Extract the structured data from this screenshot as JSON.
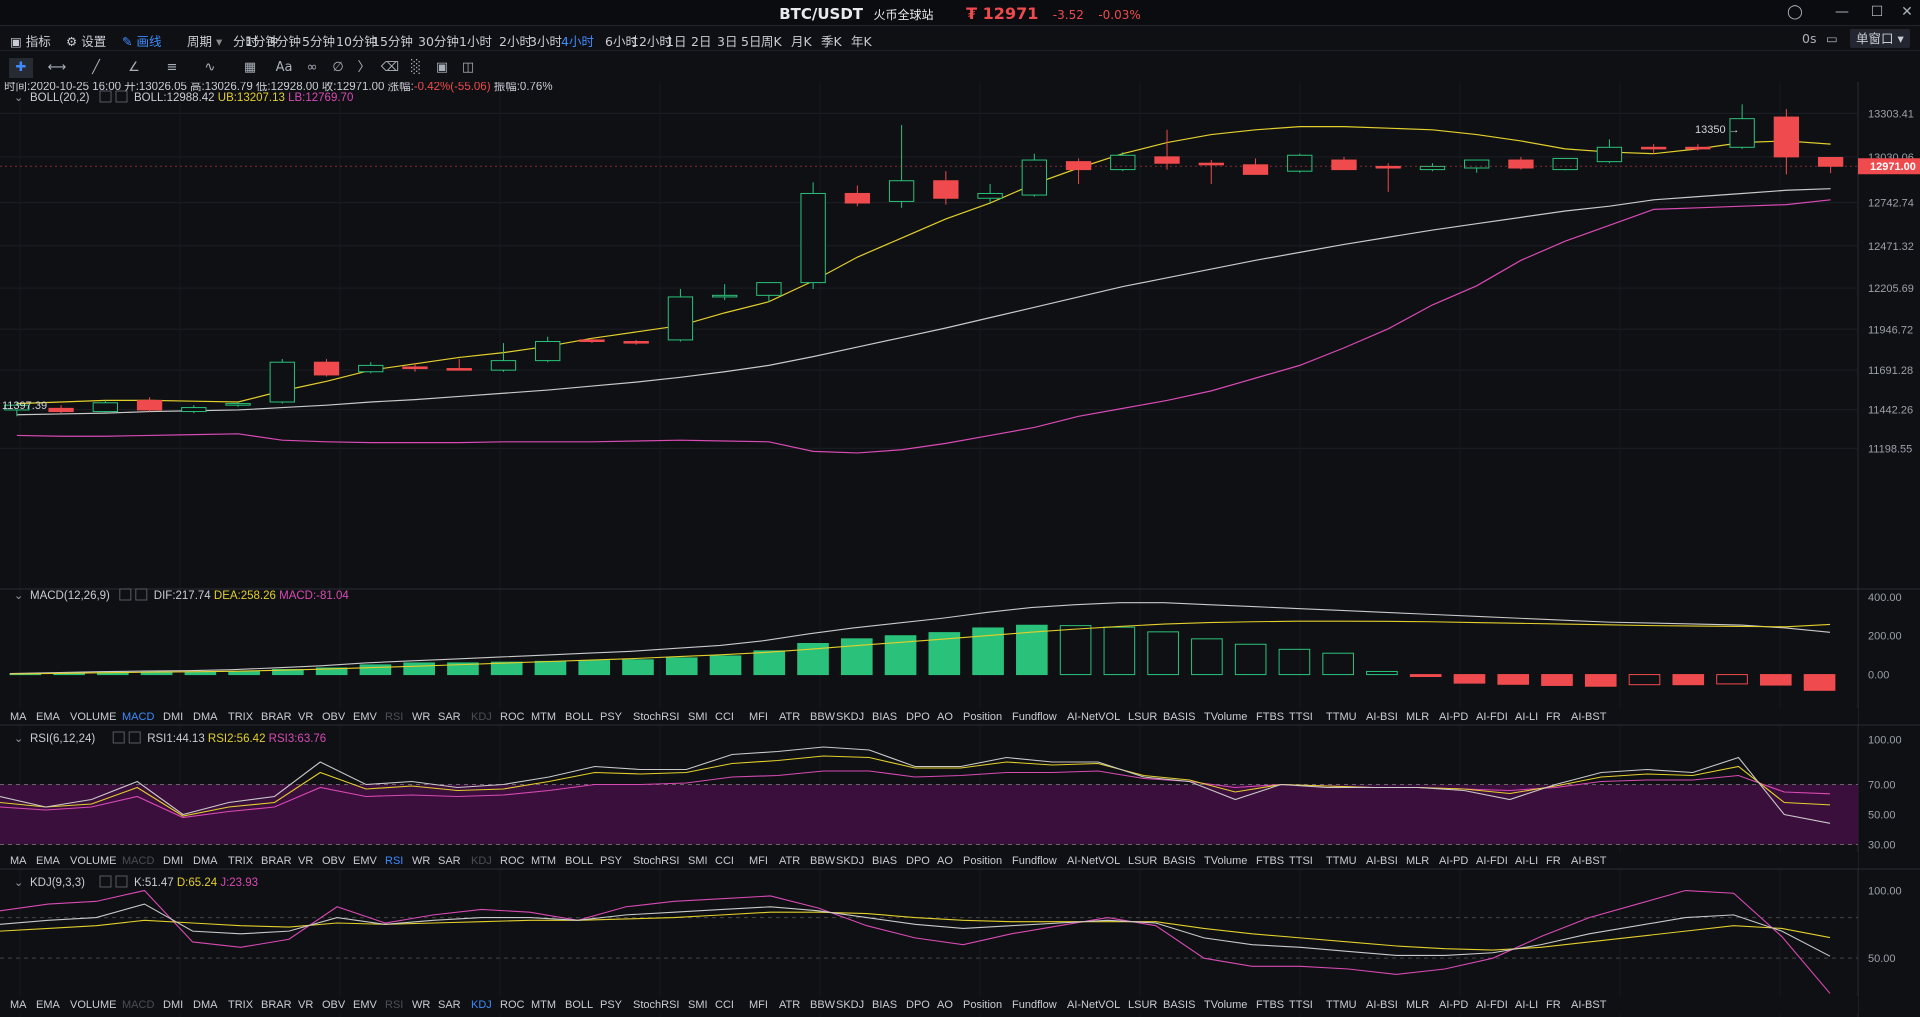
{
  "titlebar": {
    "pair": "BTC/USDT",
    "exchange": "火币全球站",
    "price": "₮ 12971",
    "change": "-3.52",
    "change_pct": "-0.03%"
  },
  "menu": {
    "indicators": "指标",
    "settings": "设置",
    "draw": "画线",
    "period": "周期",
    "timeframes": [
      "分时",
      "1分钟",
      "3分钟",
      "5分钟",
      "10分钟",
      "15分钟",
      "30分钟",
      "1小时",
      "2小时",
      "3小时",
      "4小时",
      "6小时",
      "12小时",
      "1日",
      "2日",
      "3日",
      "5日",
      "周K",
      "月K",
      "季K",
      "年K"
    ],
    "active_timeframe": "4小时",
    "refresh": "0s",
    "window_mode": "单窗口"
  },
  "ohlc_line": {
    "time": "时间:2020-10-25 16:00",
    "open": "开:13026.05",
    "high": "高:13026.79",
    "low": "低:12928.00",
    "close": "收:12971.00",
    "change": "涨幅:",
    "change_val": "-0.42%(-55.06)",
    "amp": "振幅:0.76%"
  },
  "boll_legend": {
    "name": "BOLL(20,2)",
    "mid": "BOLL:12988.42",
    "ub": "UB:13207.13",
    "lb": "LB:12769.70"
  },
  "macd_legend": {
    "name": "MACD(12,26,9)",
    "dif": "DIF:217.74",
    "dea": "DEA:258.26",
    "macd": "MACD:-81.04"
  },
  "rsi_legend": {
    "name": "RSI(6,12,24)",
    "r1": "RSI1:44.13",
    "r2": "RSI2:56.42",
    "r3": "RSI3:63.76"
  },
  "kdj_legend": {
    "name": "KDJ(9,3,3)",
    "k": "K:51.47",
    "d": "D:65.24",
    "j": "J:23.93"
  },
  "indicator_tabs": [
    "MA",
    "EMA",
    "VOLUME",
    "MACD",
    "DMI",
    "DMA",
    "TRIX",
    "BRAR",
    "VR",
    "OBV",
    "EMV",
    "RSI",
    "WR",
    "SAR",
    "KDJ",
    "ROC",
    "MTM",
    "BOLL",
    "PSY",
    "StochRSI",
    "SMI",
    "CCI",
    "MFI",
    "ATR",
    "BBW",
    "SKDJ",
    "BIAS",
    "DPO",
    "AO",
    "Position",
    "Fundflow",
    "AI-NetVOL",
    "LSUR",
    "BASIS",
    "TVolume",
    "FTBS",
    "TTSI",
    "TTMU",
    "AI-BSI",
    "MLR",
    "AI-PD",
    "AI-FDI",
    "AI-LI",
    "FR",
    "AI-BST"
  ],
  "tabs_bar1": {
    "active": "MACD",
    "dim": [
      "RSI",
      "KDJ"
    ]
  },
  "tabs_bar2": {
    "active": "RSI",
    "dim": [
      "MACD",
      "KDJ"
    ]
  },
  "tabs_bar3": {
    "active": "KDJ",
    "dim": [
      "MACD",
      "RSI"
    ]
  },
  "colors": {
    "up": "#2ac27a",
    "down": "#ef4a4d",
    "boll_mid": "#c9c9c9",
    "boll_ub": "#e3cf2c",
    "boll_lb": "#d94ab4",
    "accent": "#3d8bfd",
    "rsi_band": "#3b0f3c"
  },
  "chart_data": [
    {
      "type": "candlestick",
      "title": "BTC/USDT",
      "interval": "4小时",
      "ylim": [
        11000,
        13450
      ],
      "y_ticks": [
        13303.41,
        13030.06,
        12742.74,
        12471.32,
        12205.69,
        11946.72,
        11691.28,
        11442.26,
        11198.55
      ],
      "last_price_label": "12971.00",
      "high_marker": "13350",
      "low_marker": "11397.39",
      "candles": [
        {
          "o": 11440,
          "h": 11490,
          "l": 11400,
          "c": 11470
        },
        {
          "o": 11450,
          "h": 11470,
          "l": 11420,
          "c": 11430
        },
        {
          "o": 11430,
          "h": 11500,
          "l": 11420,
          "c": 11485
        },
        {
          "o": 11500,
          "h": 11520,
          "l": 11430,
          "c": 11440
        },
        {
          "o": 11430,
          "h": 11470,
          "l": 11420,
          "c": 11455
        },
        {
          "o": 11470,
          "h": 11490,
          "l": 11460,
          "c": 11480
        },
        {
          "o": 11490,
          "h": 11760,
          "l": 11480,
          "c": 11740
        },
        {
          "o": 11740,
          "h": 11760,
          "l": 11650,
          "c": 11660
        },
        {
          "o": 11680,
          "h": 11740,
          "l": 11670,
          "c": 11720
        },
        {
          "o": 11710,
          "h": 11730,
          "l": 11680,
          "c": 11700
        },
        {
          "o": 11700,
          "h": 11760,
          "l": 11690,
          "c": 11690
        },
        {
          "o": 11690,
          "h": 11860,
          "l": 11680,
          "c": 11750
        },
        {
          "o": 11750,
          "h": 11900,
          "l": 11740,
          "c": 11870
        },
        {
          "o": 11880,
          "h": 11890,
          "l": 11860,
          "c": 11870
        },
        {
          "o": 11870,
          "h": 11880,
          "l": 11850,
          "c": 11860
        },
        {
          "o": 11880,
          "h": 12200,
          "l": 11870,
          "c": 12150
        },
        {
          "o": 12150,
          "h": 12230,
          "l": 12130,
          "c": 12160
        },
        {
          "o": 12160,
          "h": 12240,
          "l": 12120,
          "c": 12240
        },
        {
          "o": 12240,
          "h": 12870,
          "l": 12200,
          "c": 12800
        },
        {
          "o": 12800,
          "h": 12850,
          "l": 12720,
          "c": 12740
        },
        {
          "o": 12750,
          "h": 13230,
          "l": 12710,
          "c": 12880
        },
        {
          "o": 12880,
          "h": 12940,
          "l": 12730,
          "c": 12770
        },
        {
          "o": 12770,
          "h": 12860,
          "l": 12740,
          "c": 12800
        },
        {
          "o": 12790,
          "h": 13050,
          "l": 12780,
          "c": 13010
        },
        {
          "o": 13000,
          "h": 13020,
          "l": 12860,
          "c": 12950
        },
        {
          "o": 12950,
          "h": 13060,
          "l": 12940,
          "c": 13040
        },
        {
          "o": 13030,
          "h": 13200,
          "l": 12950,
          "c": 12990
        },
        {
          "o": 12990,
          "h": 13010,
          "l": 12860,
          "c": 12980
        },
        {
          "o": 12980,
          "h": 13020,
          "l": 12920,
          "c": 12920
        },
        {
          "o": 12940,
          "h": 13050,
          "l": 12930,
          "c": 13040
        },
        {
          "o": 13010,
          "h": 13030,
          "l": 12960,
          "c": 12950
        },
        {
          "o": 12970,
          "h": 12990,
          "l": 12810,
          "c": 12960
        },
        {
          "o": 12950,
          "h": 12990,
          "l": 12940,
          "c": 12970
        },
        {
          "o": 12960,
          "h": 12990,
          "l": 12930,
          "c": 13010
        },
        {
          "o": 13010,
          "h": 13030,
          "l": 12950,
          "c": 12960
        },
        {
          "o": 12950,
          "h": 13010,
          "l": 12945,
          "c": 13020
        },
        {
          "o": 13000,
          "h": 13140,
          "l": 12990,
          "c": 13090
        },
        {
          "o": 13090,
          "h": 13110,
          "l": 13050,
          "c": 13080
        },
        {
          "o": 13090,
          "h": 13110,
          "l": 13070,
          "c": 13080
        },
        {
          "o": 13090,
          "h": 13360,
          "l": 13080,
          "c": 13270
        },
        {
          "o": 13280,
          "h": 13330,
          "l": 12920,
          "c": 13030
        },
        {
          "o": 13026.05,
          "h": 13026.79,
          "l": 12928,
          "c": 12971
        }
      ],
      "boll_ub": [
        11480,
        11490,
        11500,
        11500,
        11495,
        11490,
        11560,
        11620,
        11690,
        11730,
        11770,
        11800,
        11840,
        11890,
        11930,
        11970,
        12050,
        12120,
        12250,
        12400,
        12520,
        12640,
        12740,
        12860,
        12960,
        13050,
        13120,
        13170,
        13200,
        13220,
        13220,
        13210,
        13200,
        13170,
        13130,
        13080,
        13060,
        13050,
        13080,
        13120,
        13130,
        13110
      ],
      "boll_mid": [
        11410,
        11415,
        11420,
        11430,
        11435,
        11440,
        11455,
        11470,
        11490,
        11505,
        11525,
        11545,
        11565,
        11590,
        11615,
        11645,
        11680,
        11720,
        11775,
        11835,
        11895,
        11955,
        12020,
        12085,
        12150,
        12215,
        12270,
        12325,
        12380,
        12430,
        12480,
        12525,
        12570,
        12610,
        12650,
        12690,
        12720,
        12760,
        12780,
        12800,
        12820,
        12830
      ],
      "boll_lb": [
        11280,
        11275,
        11275,
        11280,
        11285,
        11290,
        11250,
        11240,
        11235,
        11235,
        11235,
        11240,
        11240,
        11240,
        11245,
        11250,
        11245,
        11240,
        11180,
        11170,
        11190,
        11230,
        11280,
        11330,
        11400,
        11450,
        11500,
        11560,
        11640,
        11720,
        11830,
        11950,
        12100,
        12220,
        12380,
        12500,
        12600,
        12700,
        12710,
        12720,
        12730,
        12760
      ]
    },
    {
      "type": "bar+line",
      "title": "MACD(12,26,9)",
      "ylim": [
        -100,
        420
      ],
      "y_ticks": [
        400,
        200,
        0
      ],
      "dif": [
        5,
        10,
        15,
        18,
        20,
        25,
        35,
        45,
        60,
        70,
        80,
        90,
        100,
        110,
        120,
        135,
        150,
        175,
        210,
        240,
        265,
        290,
        320,
        345,
        360,
        370,
        370,
        360,
        350,
        340,
        330,
        320,
        310,
        300,
        290,
        280,
        270,
        265,
        260,
        255,
        240,
        217.74
      ],
      "dea": [
        3,
        6,
        9,
        12,
        14,
        17,
        22,
        28,
        35,
        42,
        50,
        58,
        66,
        74,
        82,
        92,
        102,
        114,
        130,
        148,
        165,
        182,
        200,
        218,
        234,
        248,
        260,
        268,
        272,
        275,
        275,
        274,
        272,
        268,
        264,
        260,
        256,
        252,
        250,
        248,
        246,
        258.26
      ],
      "hist": [
        5,
        8,
        10,
        12,
        14,
        16,
        26,
        34,
        50,
        60,
        60,
        64,
        68,
        72,
        76,
        86,
        96,
        122,
        160,
        184,
        200,
        216,
        240,
        254,
        252,
        244,
        220,
        184,
        156,
        130,
        110,
        16,
        -10,
        -44,
        -50,
        -56,
        -60,
        -52,
        -52,
        -48,
        -54,
        -81.04
      ]
    },
    {
      "type": "line",
      "title": "RSI(6,12,24)",
      "ylim": [
        25,
        105
      ],
      "y_ticks": [
        100,
        70,
        50,
        30
      ],
      "rsi1": [
        62,
        55,
        60,
        72,
        50,
        58,
        62,
        85,
        70,
        72,
        68,
        70,
        75,
        82,
        80,
        80,
        90,
        92,
        95,
        93,
        82,
        82,
        88,
        85,
        85,
        75,
        72,
        60,
        70,
        68,
        68,
        68,
        66,
        60,
        70,
        78,
        80,
        78,
        88,
        50,
        44.13
      ],
      "rsi2": [
        58,
        55,
        57,
        68,
        49,
        55,
        58,
        78,
        67,
        69,
        66,
        67,
        72,
        78,
        77,
        78,
        84,
        86,
        89,
        88,
        81,
        81,
        85,
        83,
        84,
        76,
        73,
        65,
        70,
        69,
        68,
        68,
        67,
        64,
        69,
        75,
        77,
        76,
        82,
        58,
        56.42
      ],
      "rsi3": [
        55,
        53,
        55,
        62,
        48,
        52,
        55,
        68,
        62,
        63,
        62,
        63,
        66,
        70,
        70,
        71,
        75,
        76,
        79,
        79,
        75,
        76,
        78,
        78,
        79,
        74,
        72,
        68,
        70,
        69,
        68,
        68,
        67,
        66,
        68,
        72,
        73,
        73,
        76,
        65,
        63.76
      ]
    },
    {
      "type": "line",
      "title": "KDJ(9,3,3)",
      "ylim": [
        25,
        110
      ],
      "y_ticks": [
        100,
        50
      ],
      "k": [
        75,
        78,
        80,
        90,
        70,
        68,
        70,
        80,
        75,
        78,
        80,
        80,
        78,
        82,
        84,
        86,
        88,
        85,
        80,
        75,
        72,
        74,
        76,
        78,
        76,
        65,
        60,
        58,
        55,
        52,
        52,
        54,
        60,
        68,
        74,
        80,
        82,
        70,
        51.47
      ],
      "d": [
        70,
        72,
        74,
        78,
        76,
        74,
        73,
        76,
        75,
        76,
        77,
        78,
        78,
        79,
        80,
        82,
        84,
        84,
        83,
        80,
        78,
        77,
        77,
        77,
        77,
        72,
        68,
        65,
        62,
        59,
        57,
        56,
        58,
        62,
        66,
        70,
        74,
        72,
        65.24
      ],
      "j": [
        85,
        90,
        92,
        100,
        62,
        58,
        64,
        88,
        76,
        82,
        86,
        84,
        78,
        88,
        92,
        94,
        96,
        87,
        74,
        65,
        60,
        68,
        74,
        80,
        74,
        50,
        44,
        44,
        42,
        38,
        42,
        50,
        66,
        80,
        90,
        100,
        98,
        66,
        23.93
      ]
    }
  ]
}
